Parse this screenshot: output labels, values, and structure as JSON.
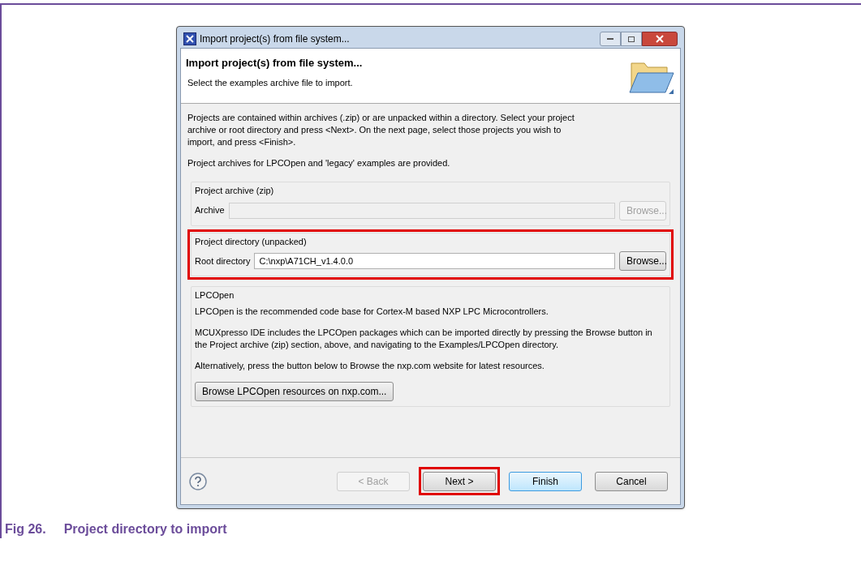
{
  "dialog": {
    "title": "Import project(s) from file system...",
    "header": {
      "title": "Import project(s) from file system...",
      "subtitle": "Select the examples archive file to import."
    },
    "intro": [
      "Projects are contained within archives (.zip) or are unpacked within a directory. Select your project archive or root directory and press <Next>. On the next page, select those projects you wish to import, and press <Finish>.",
      "Project archives for LPCOpen and 'legacy' examples are provided."
    ],
    "groups": [
      {
        "kind": "field",
        "title": "Project archive (zip)",
        "label": "Archive",
        "button": "Browse...",
        "disabled": true,
        "highlighted": false
      },
      {
        "kind": "field",
        "title": "Project directory (unpacked)",
        "label": "Root directory",
        "value": "C:\\nxp\\A71CH_v1.4.0.0",
        "button": "Browse...",
        "disabled": false,
        "highlighted": true
      },
      {
        "kind": "info",
        "title": "LPCOpen",
        "paragraphs": [
          "LPCOpen is the recommended code base for Cortex-M based NXP LPC Microcontrollers.",
          "MCUXpresso IDE includes the LPCOpen packages which can be imported directly by pressing the Browse button in the Project archive (zip) section, above, and navigating to the Examples/LPCOpen directory.",
          "Alternatively, press the button below to Browse the nxp.com website for latest resources."
        ],
        "button": "Browse LPCOpen resources on nxp.com...",
        "highlighted": false
      }
    ],
    "buttons": [
      {
        "label": "< Back",
        "disabled": true,
        "default": false,
        "highlighted": false
      },
      {
        "label": "Next >",
        "disabled": false,
        "default": false,
        "highlighted": true
      },
      {
        "label": "Finish",
        "disabled": false,
        "default": true,
        "highlighted": false
      },
      {
        "label": "Cancel",
        "disabled": false,
        "default": false,
        "highlighted": false
      }
    ]
  },
  "caption": {
    "number": "Fig 26.",
    "text": "Project directory to import"
  }
}
